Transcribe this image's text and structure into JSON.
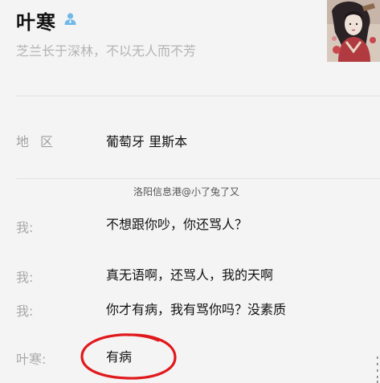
{
  "profile": {
    "name": "叶寒",
    "signature": "芝兰长于深林，不以无人而不芳"
  },
  "region": {
    "label": "地区",
    "value": "葡萄牙 里斯本"
  },
  "watermark": "洛阳信息港@小了兔了又",
  "messages": [
    {
      "speaker": "我:",
      "text": "不想跟你吵，你还骂人？"
    },
    {
      "speaker": "我:",
      "text": "真无语啊，还骂人，我的天啊"
    },
    {
      "speaker": "我:",
      "text": "你才有病，我有骂你吗？没素质"
    },
    {
      "speaker": "叶寒:",
      "text": "有病"
    }
  ],
  "colors": {
    "background": "#f4f4f4",
    "person_icon": "#6fb8e8",
    "annotation_circle": "#e0191d",
    "divider": "#e2e2e2"
  },
  "icons": {
    "person": "person-icon"
  }
}
